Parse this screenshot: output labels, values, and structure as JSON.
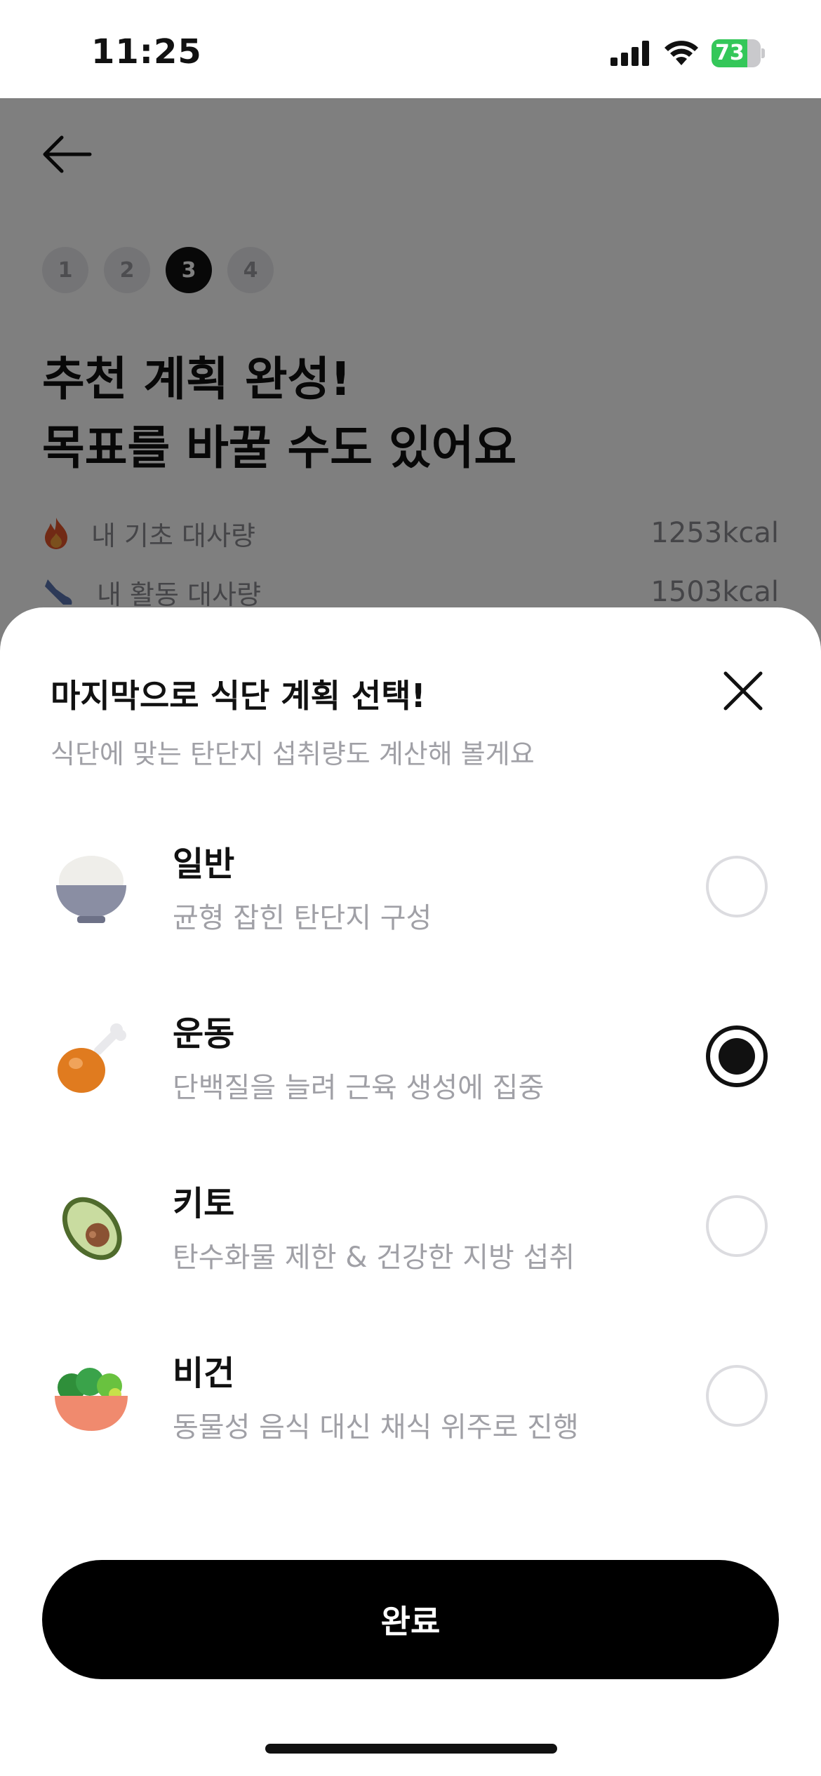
{
  "status_bar": {
    "time": "11:25",
    "battery": "73",
    "battery_level_pct": 73
  },
  "steps": [
    "1",
    "2",
    "3",
    "4"
  ],
  "active_step": "3",
  "page_title_line1": "추천 계획 완성!",
  "page_title_line2": "목표를 바꿀 수도 있어요",
  "metrics": [
    {
      "label": "내 기초 대사량",
      "value": "1253kcal",
      "icon": "fire-icon"
    },
    {
      "label": "내 활동 대사량",
      "value": "1503kcal",
      "icon": "shoe-icon"
    }
  ],
  "sheet": {
    "title": "마지막으로 식단 계획 선택!",
    "subtitle": "식단에 맞는 탄단지 섭취량도 계산해 볼게요",
    "options": [
      {
        "name": "일반",
        "desc": "균형 잡힌 탄단지 구성",
        "icon": "rice-bowl-icon",
        "selected": false
      },
      {
        "name": "운동",
        "desc": "단백질을 늘려 근육 생성에 집중",
        "icon": "chicken-leg-icon",
        "selected": true
      },
      {
        "name": "키토",
        "desc": "탄수화물 제한 & 건강한 지방 섭취",
        "icon": "avocado-icon",
        "selected": false
      },
      {
        "name": "비건",
        "desc": "동물성 음식 대신 채식 위주로 진행",
        "icon": "salad-bowl-icon",
        "selected": false
      }
    ],
    "done_label": "완료"
  },
  "colors": {
    "accent": "#000000",
    "battery_green": "#34c759",
    "muted_text": "#a0a0a6"
  }
}
